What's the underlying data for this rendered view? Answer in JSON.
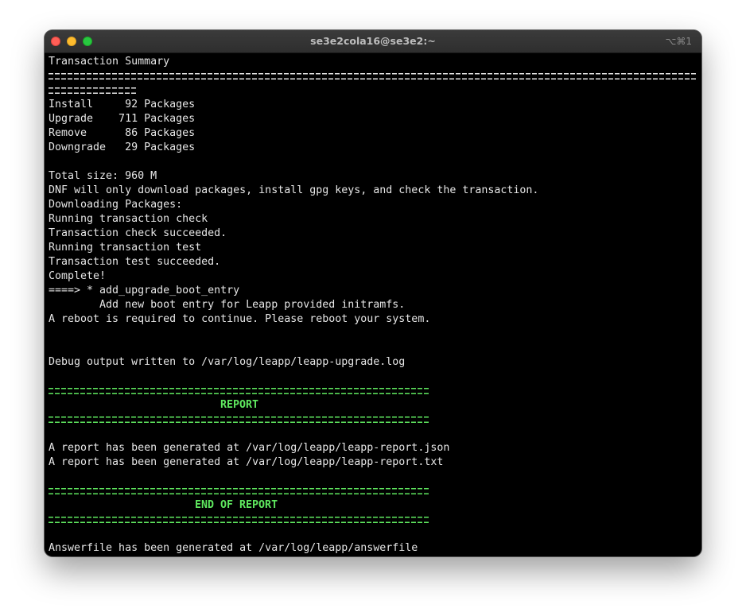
{
  "window": {
    "title": "se3e2cola16@se3e2:~",
    "shortcut": "⌥⌘1"
  },
  "terminal": {
    "transaction_summary": "Transaction Summary",
    "packages": [
      "Install     92 Packages",
      "Upgrade    711 Packages",
      "Remove      86 Packages",
      "Downgrade   29 Packages"
    ],
    "total_size": "Total size: 960 M",
    "dnf_note": "DNF will only download packages, install gpg keys, and check the transaction.",
    "downloading": "Downloading Packages:",
    "running_check": "Running transaction check",
    "check_succeeded": "Transaction check succeeded.",
    "running_test": "Running transaction test",
    "test_succeeded": "Transaction test succeeded.",
    "complete": "Complete!",
    "boot_entry": "====> * add_upgrade_boot_entry",
    "boot_entry_desc": "        Add new boot entry for Leapp provided initramfs.",
    "reboot_required": "A reboot is required to continue. Please reboot your system.",
    "debug_output": "Debug output written to /var/log/leapp/leapp-upgrade.log",
    "report_heading": "REPORT",
    "report_json": "A report has been generated at /var/log/leapp/leapp-report.json",
    "report_txt": "A report has been generated at /var/log/leapp/leapp-report.txt",
    "end_of_report": "END OF REPORT",
    "answerfile": "Answerfile has been generated at /var/log/leapp/answerfile"
  },
  "colors": {
    "background": "#000000",
    "text": "#e6e6e6",
    "highlight_green": "#5fe85f"
  }
}
